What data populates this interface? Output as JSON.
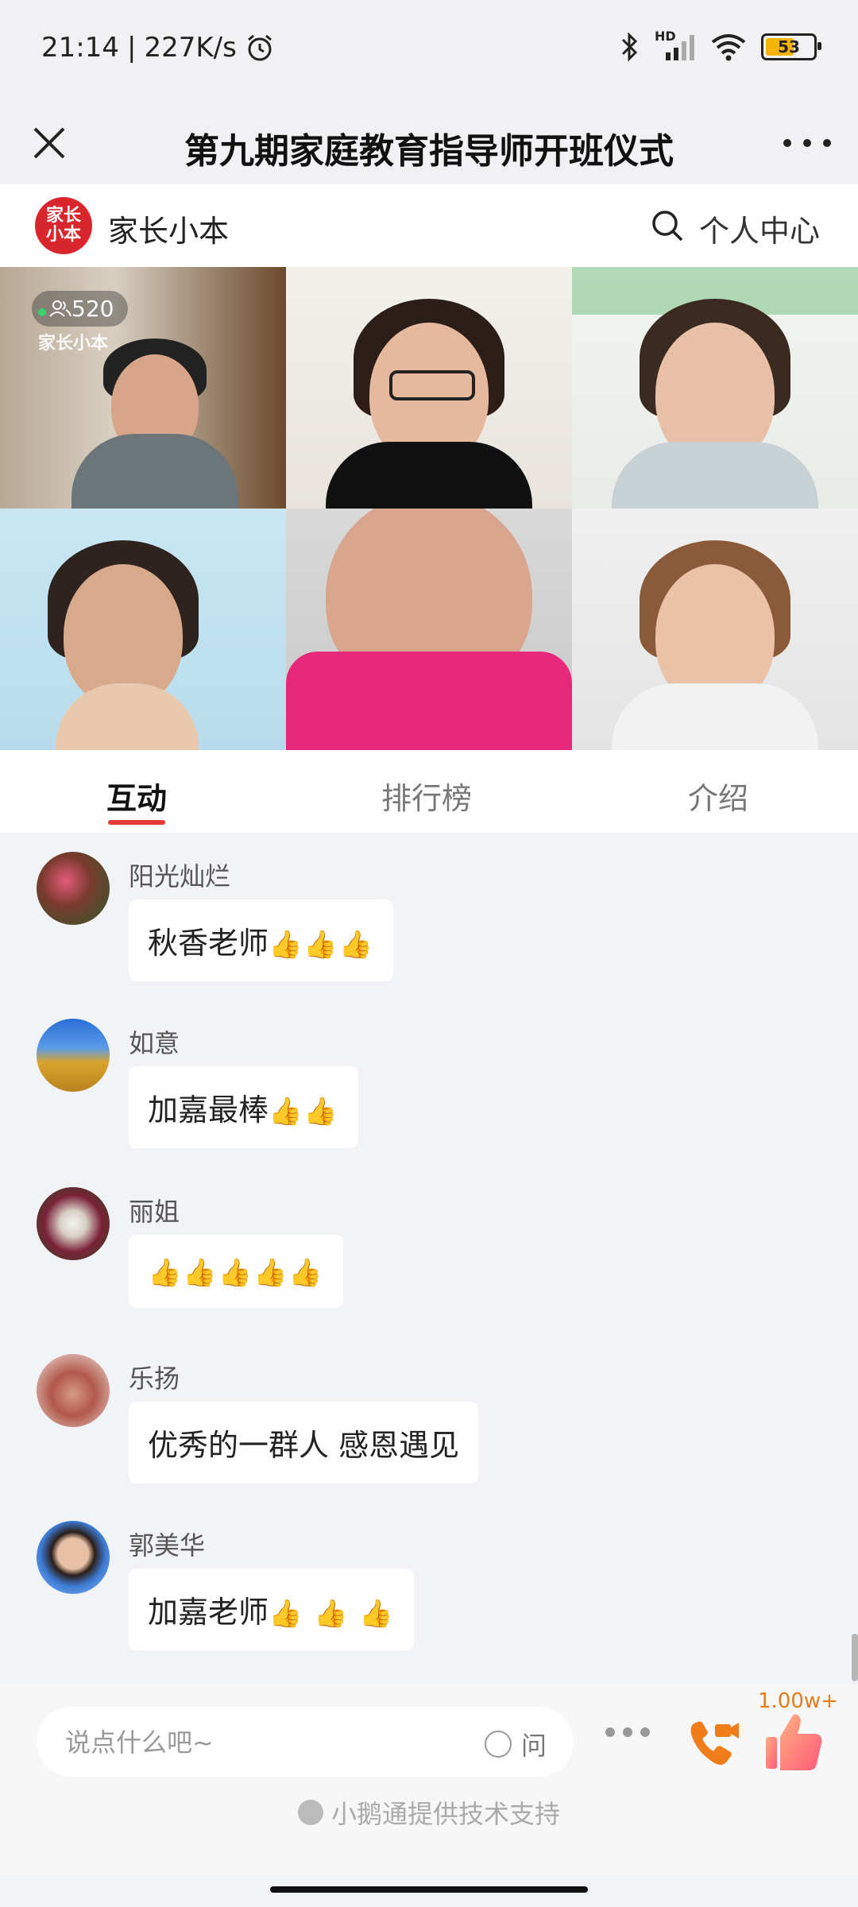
{
  "status_bar": {
    "time": "21:14",
    "speed": "227K/s",
    "battery": "53",
    "hd_label": "HD"
  },
  "title_bar": {
    "title": "第九期家庭教育指导师开班仪式"
  },
  "brand_bar": {
    "logo_text": "家长\n小本",
    "app_name": "家长小本",
    "personal_center": "个人中心"
  },
  "video_grid": {
    "viewer_count": "520",
    "watermark": "家长小本"
  },
  "tabs": [
    {
      "label": "互动",
      "active": true
    },
    {
      "label": "排行榜",
      "active": false
    },
    {
      "label": "介绍",
      "active": false
    }
  ],
  "messages": [
    {
      "user": "阳光灿烂",
      "text": "秋香老师",
      "thumbs": "👍👍👍"
    },
    {
      "user": "如意",
      "text": "加嘉最棒",
      "thumbs": "👍👍"
    },
    {
      "user": "丽姐",
      "text": "",
      "thumbs": "👍👍👍👍👍"
    },
    {
      "user": "乐扬",
      "text": "优秀的一群人 感恩遇见",
      "thumbs": ""
    },
    {
      "user": "郭美华",
      "text": "加嘉老师",
      "thumbs": "👍 👍 👍"
    }
  ],
  "input_bar": {
    "placeholder": "说点什么吧~",
    "ask_label": "问",
    "like_count": "1.00w+"
  },
  "footer": {
    "support_text": "小鹅通提供技术支持"
  },
  "colors": {
    "accent": "#e63a3a",
    "brand_red": "#d9262c",
    "like_orange": "#e57b1b"
  }
}
